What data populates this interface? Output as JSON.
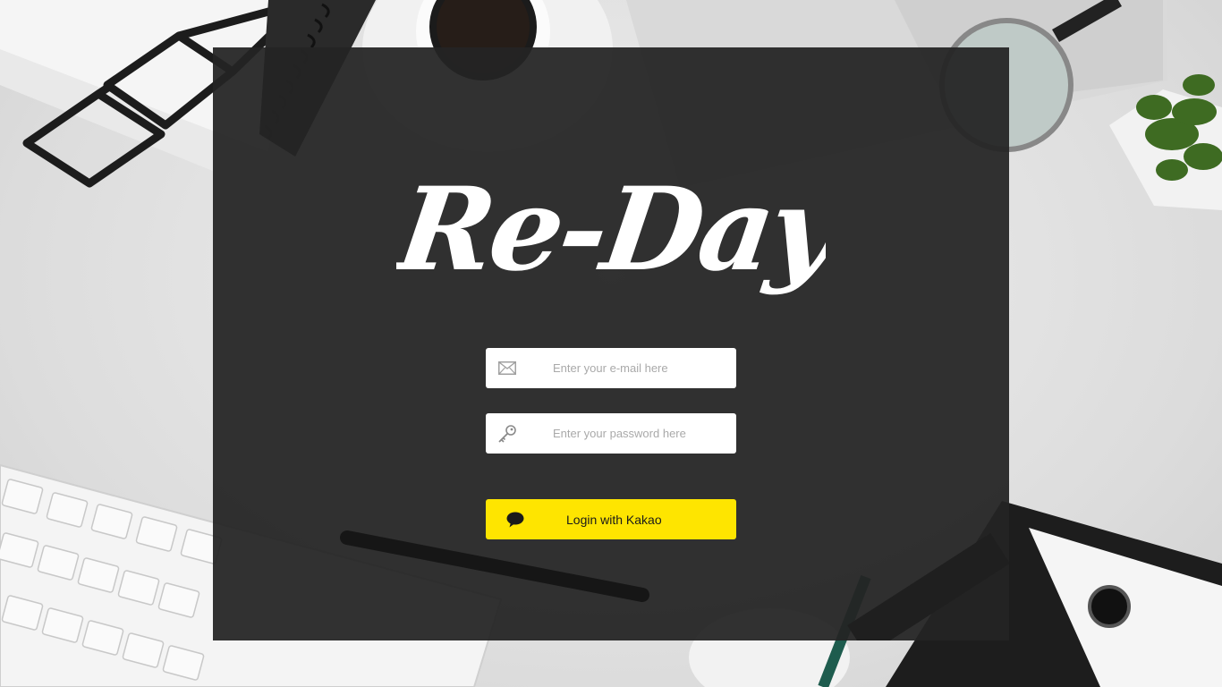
{
  "app": {
    "logo_text": "Re-Day"
  },
  "login": {
    "email_placeholder": "Enter your e-mail here",
    "password_placeholder": "Enter your password here",
    "kakao_button_label": "Login with Kakao"
  },
  "icons": {
    "email": "envelope-icon",
    "password": "key-icon",
    "kakao": "speech-bubble-icon"
  },
  "colors": {
    "panel_background": "#242424",
    "kakao_yellow": "#fee500",
    "logo": "#ffffff"
  }
}
